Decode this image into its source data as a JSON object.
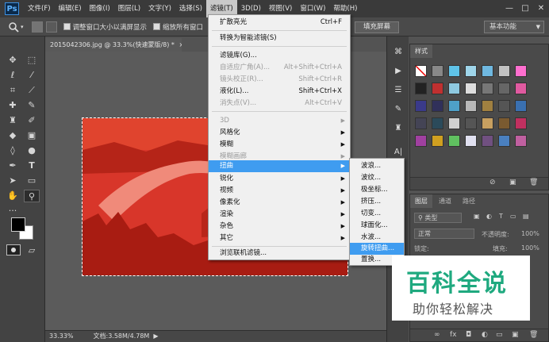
{
  "app": {
    "logo": "Ps"
  },
  "menubar": {
    "items": [
      "文件(F)",
      "编辑(E)",
      "图像(I)",
      "图层(L)",
      "文字(Y)",
      "选择(S)",
      "滤镜(T)",
      "3D(D)",
      "视图(V)",
      "窗口(W)",
      "帮助(H)"
    ],
    "active_index": 6
  },
  "window_controls": {
    "minimize": "—",
    "restore": "□",
    "close": "✕"
  },
  "options_bar": {
    "checkbox1_label": "调整窗口大小以满屏显示",
    "checkbox2_label": "缩放所有窗口",
    "fill_screen_button": "填充屏幕",
    "workspace": "基本功能"
  },
  "document": {
    "tab_title": "2015042306.jpg @ 33.3%(快速蒙版/8) *",
    "tab_close": "×",
    "zoom": "33.33%",
    "doc_size": "文档:3.58M/4.78M",
    "status_arrow": "▶"
  },
  "filter_menu": {
    "items": [
      {
        "label": "扩散亮光",
        "shortcut": "Ctrl+F",
        "disabled": false
      },
      {
        "label": "转换为智能滤镜(S)",
        "shortcut": "",
        "disabled": false
      },
      {
        "label": "滤镜库(G)...",
        "shortcut": "",
        "disabled": false
      },
      {
        "label": "自适应广角(A)...",
        "shortcut": "Alt+Shift+Ctrl+A",
        "disabled": true
      },
      {
        "label": "镜头校正(R)...",
        "shortcut": "Shift+Ctrl+R",
        "disabled": true
      },
      {
        "label": "液化(L)...",
        "shortcut": "Shift+Ctrl+X",
        "disabled": false
      },
      {
        "label": "消失点(V)...",
        "shortcut": "Alt+Ctrl+V",
        "disabled": true
      },
      {
        "label": "3D",
        "submenu": true,
        "disabled": true
      },
      {
        "label": "风格化",
        "submenu": true,
        "disabled": false
      },
      {
        "label": "模糊",
        "submenu": true,
        "disabled": false
      },
      {
        "label": "模糊画廊",
        "submenu": true,
        "disabled": true
      },
      {
        "label": "扭曲",
        "submenu": true,
        "disabled": false,
        "highlighted": true
      },
      {
        "label": "锐化",
        "submenu": true,
        "disabled": false
      },
      {
        "label": "视频",
        "submenu": true,
        "disabled": false
      },
      {
        "label": "像素化",
        "submenu": true,
        "disabled": false
      },
      {
        "label": "渲染",
        "submenu": true,
        "disabled": false
      },
      {
        "label": "杂色",
        "submenu": true,
        "disabled": false
      },
      {
        "label": "其它",
        "submenu": true,
        "disabled": false
      },
      {
        "label": "浏览联机滤镜...",
        "shortcut": "",
        "disabled": false
      }
    ],
    "submenu_arrow": "▶"
  },
  "distort_submenu": {
    "items": [
      "波浪...",
      "波纹...",
      "极坐标...",
      "挤压...",
      "切变...",
      "球面化...",
      "水波...",
      "旋转扭曲...",
      "置换..."
    ],
    "highlighted_index": 7
  },
  "styles_panel": {
    "tab": "样式"
  },
  "layers_panel": {
    "tabs": [
      "图层",
      "通道",
      "路径"
    ],
    "filter_kind": "类型",
    "blend_mode": "正常",
    "opacity_label": "不透明度:",
    "opacity_value": "100%",
    "lock_label": "锁定:",
    "fill_label": "填充:",
    "fill_value": "100%"
  },
  "watermark": {
    "title": "百科全说",
    "subtitle": "助你轻松解决"
  },
  "colors": {
    "accent": "#3f9cf0",
    "brand": "#1fa97f",
    "menu_bg": "#f0f0f0"
  }
}
